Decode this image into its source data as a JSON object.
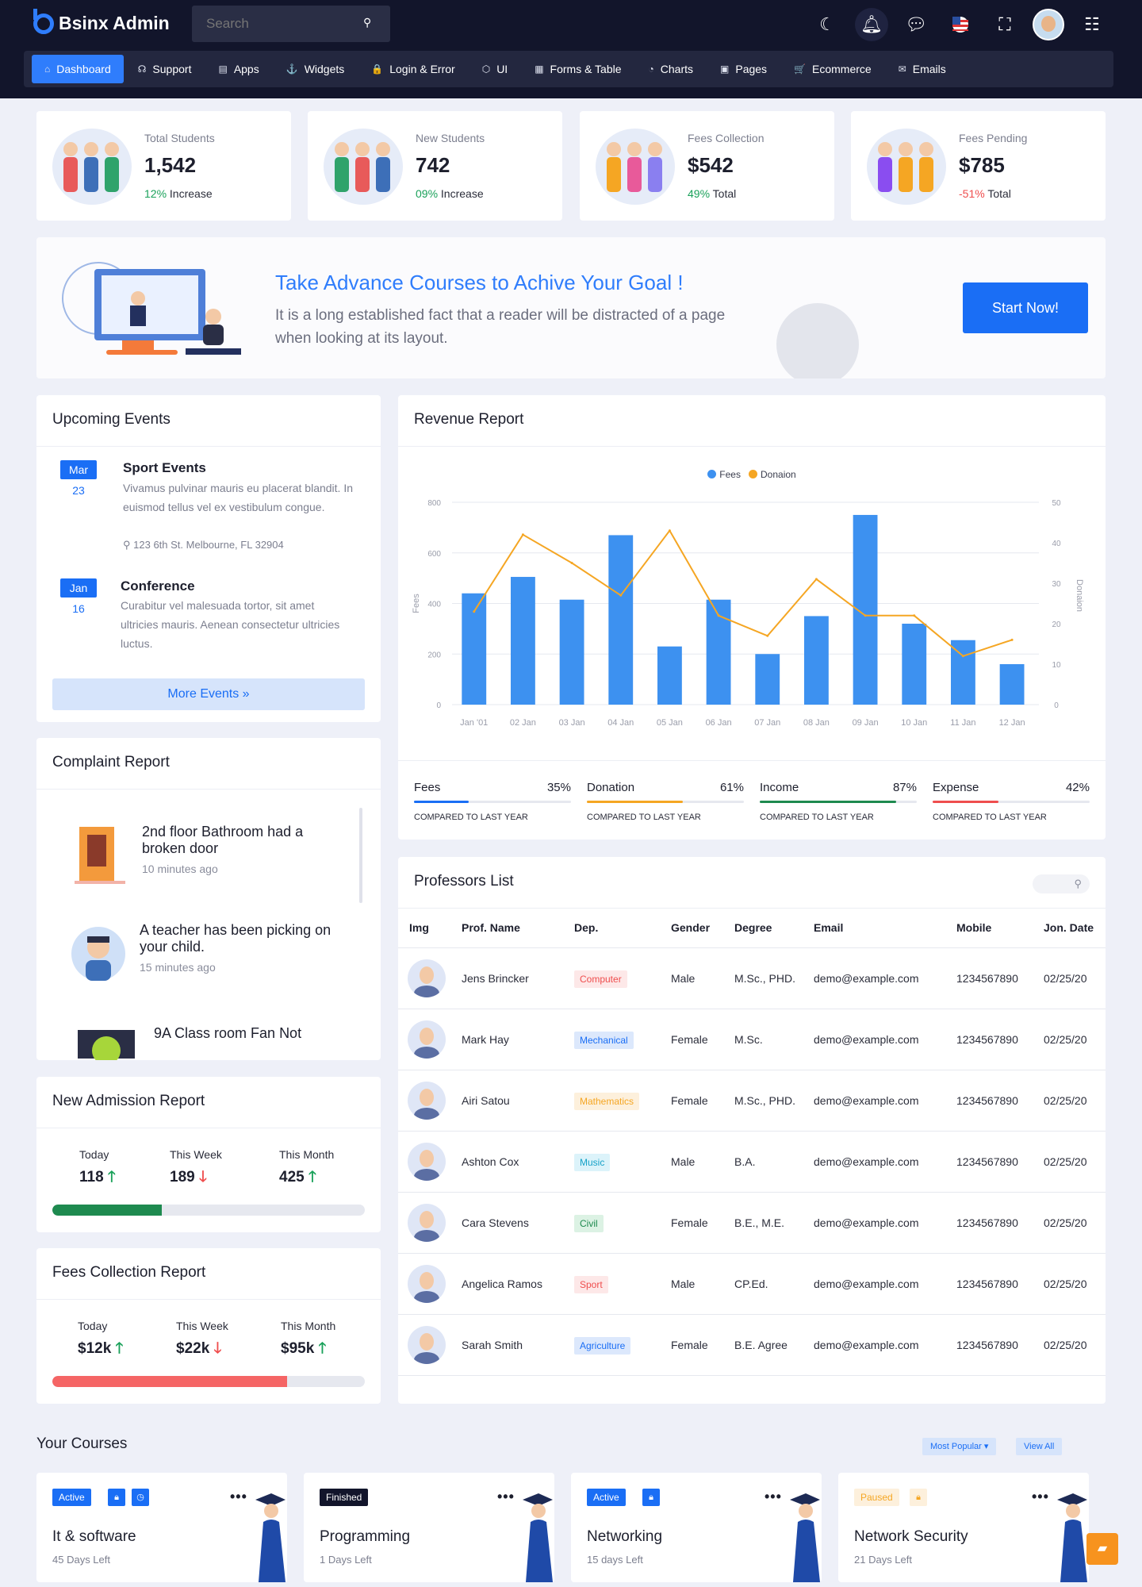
{
  "header": {
    "app_title": "Bsinx Admin",
    "search_placeholder": "Search",
    "icons": [
      "moon-icon",
      "bell-icon",
      "chat-icon",
      "flag-icon",
      "fullscreen-icon",
      "avatar",
      "settings-sliders-icon"
    ]
  },
  "nav": [
    {
      "label": "Dashboard",
      "icon": "home-icon",
      "glyph": "⌂",
      "active": true
    },
    {
      "label": "Support",
      "icon": "headset-icon",
      "glyph": "☊"
    },
    {
      "label": "Apps",
      "icon": "apps-icon",
      "glyph": "▤"
    },
    {
      "label": "Widgets",
      "icon": "anchor-icon",
      "glyph": "⚓"
    },
    {
      "label": "Login & Error",
      "icon": "lock-icon",
      "glyph": "🔒"
    },
    {
      "label": "UI",
      "icon": "box-icon",
      "glyph": "⬡"
    },
    {
      "label": "Forms & Table",
      "icon": "table-icon",
      "glyph": "▦"
    },
    {
      "label": "Charts",
      "icon": "pie-icon",
      "glyph": "◔"
    },
    {
      "label": "Pages",
      "icon": "page-icon",
      "glyph": "▣"
    },
    {
      "label": "Ecommerce",
      "icon": "cart-icon",
      "glyph": "🛒"
    },
    {
      "label": "Emails",
      "icon": "mail-icon",
      "glyph": "✉"
    }
  ],
  "stats": [
    {
      "label": "Total Students",
      "value": "1,542",
      "pct": "12%",
      "note": "Increase",
      "trend": "up"
    },
    {
      "label": "New Students",
      "value": "742",
      "pct": "09%",
      "note": "Increase",
      "trend": "up"
    },
    {
      "label": "Fees Collection",
      "value": "$542",
      "pct": "49%",
      "note": "Total",
      "trend": "up"
    },
    {
      "label": "Fees Pending",
      "value": "$785",
      "pct": "-51%",
      "note": "Total",
      "trend": "down"
    }
  ],
  "banner": {
    "title": "Take Advance Courses to Achive Your Goal !",
    "text": "It is a long established fact that a reader will be distracted of a page when looking at its layout.",
    "button": "Start Now!"
  },
  "events": {
    "title": "Upcoming Events",
    "items": [
      {
        "month": "Mar",
        "day": "23",
        "title": "Sport Events",
        "desc": "Vivamus pulvinar mauris eu placerat blandit. In euismod tellus vel ex vestibulum congue.",
        "address": "123 6th St. Melbourne, FL 32904"
      },
      {
        "month": "Jan",
        "day": "16",
        "title": "Conference",
        "desc": "Curabitur vel malesuada tortor, sit amet ultricies mauris. Aenean consectetur ultricies luctus."
      }
    ],
    "button": "More Events »"
  },
  "complaints": {
    "title": "Complaint Report",
    "items": [
      {
        "title": "2nd floor Bathroom had a broken door",
        "time": "10 minutes ago"
      },
      {
        "title": "A teacher has been picking on your child.",
        "time": "15 minutes ago"
      },
      {
        "title": "9A Class room Fan Not",
        "time": ""
      }
    ]
  },
  "admission": {
    "title": "New Admission Report",
    "cols": [
      {
        "label": "Today",
        "value": "118",
        "trend": "up"
      },
      {
        "label": "This Week",
        "value": "189",
        "trend": "down"
      },
      {
        "label": "This Month",
        "value": "425",
        "trend": "up"
      }
    ],
    "progress": 0.35,
    "color": "#1e8a4f"
  },
  "fees": {
    "title": "Fees Collection Report",
    "cols": [
      {
        "label": "Today",
        "value": "$12k",
        "trend": "up"
      },
      {
        "label": "This Week",
        "value": "$22k",
        "trend": "down"
      },
      {
        "label": "This Month",
        "value": "$95k",
        "trend": "up"
      }
    ],
    "progress": 0.75,
    "color": "#f56565"
  },
  "revenue": {
    "title": "Revenue Report",
    "kpis": [
      {
        "label": "Fees",
        "pct": "35%",
        "value": 0.35,
        "color": "#1a6ef5",
        "sub": "COMPARED TO LAST YEAR"
      },
      {
        "label": "Donation",
        "pct": "61%",
        "value": 0.61,
        "color": "#f5a623",
        "sub": "COMPARED TO LAST YEAR"
      },
      {
        "label": "Income",
        "pct": "87%",
        "value": 0.87,
        "color": "#1e8a4f",
        "sub": "COMPARED TO LAST YEAR"
      },
      {
        "label": "Expense",
        "pct": "42%",
        "value": 0.42,
        "color": "#ef4e4e",
        "sub": "COMPARED TO LAST YEAR"
      }
    ]
  },
  "chart_data": {
    "type": "bar",
    "categories": [
      "Jan '01",
      "02 Jan",
      "03 Jan",
      "04 Jan",
      "05 Jan",
      "06 Jan",
      "07 Jan",
      "08 Jan",
      "09 Jan",
      "10 Jan",
      "11 Jan",
      "12 Jan"
    ],
    "series": [
      {
        "name": "Fees",
        "type": "bar",
        "axis": "left",
        "color": "#3d91f0",
        "values": [
          440,
          505,
          415,
          670,
          230,
          415,
          200,
          350,
          750,
          320,
          255,
          160
        ]
      },
      {
        "name": "Donaion",
        "type": "line",
        "axis": "right",
        "color": "#f5a623",
        "values": [
          23,
          42,
          35,
          27,
          43,
          22,
          17,
          31,
          22,
          22,
          12,
          16
        ]
      }
    ],
    "ylabel": "Fees",
    "y2label": "Donaion",
    "ylim": [
      0,
      800
    ],
    "y2lim": [
      0,
      50
    ],
    "yticks": [
      "0",
      "200",
      "400",
      "600",
      "800"
    ],
    "y2ticks": [
      "0",
      "10",
      "20",
      "30",
      "40",
      "50"
    ],
    "legend": "top-center",
    "grid": true
  },
  "professors": {
    "title": "Professors List",
    "headers": [
      "Img",
      "Prof. Name",
      "Dep.",
      "Gender",
      "Degree",
      "Email",
      "Mobile",
      "Jon. Date"
    ],
    "rows": [
      {
        "name": "Jens Brincker",
        "dep": "Computer",
        "dep_color": "#ef4e4e",
        "dep_bg": "#fde8e8",
        "gender": "Male",
        "degree": "M.Sc., PHD.",
        "email": "demo@example.com",
        "mobile": "1234567890",
        "date": "02/25/20"
      },
      {
        "name": "Mark Hay",
        "dep": "Mechanical",
        "dep_color": "#1a6ef5",
        "dep_bg": "#dce8fc",
        "gender": "Female",
        "degree": "M.Sc.",
        "email": "demo@example.com",
        "mobile": "1234567890",
        "date": "02/25/20"
      },
      {
        "name": "Airi Satou",
        "dep": "Mathematics",
        "dep_color": "#f5a623",
        "dep_bg": "#fdf0dc",
        "gender": "Female",
        "degree": "M.Sc., PHD.",
        "email": "demo@example.com",
        "mobile": "1234567890",
        "date": "02/25/20"
      },
      {
        "name": "Ashton Cox",
        "dep": "Music",
        "dep_color": "#16a2c8",
        "dep_bg": "#dcf3fa",
        "gender": "Male",
        "degree": "B.A.",
        "email": "demo@example.com",
        "mobile": "1234567890",
        "date": "02/25/20"
      },
      {
        "name": "Cara Stevens",
        "dep": "Civil",
        "dep_color": "#1e8a4f",
        "dep_bg": "#dcf2e4",
        "gender": "Female",
        "degree": "B.E., M.E.",
        "email": "demo@example.com",
        "mobile": "1234567890",
        "date": "02/25/20"
      },
      {
        "name": "Angelica Ramos",
        "dep": "Sport",
        "dep_color": "#ef4e4e",
        "dep_bg": "#fde8e8",
        "gender": "Male",
        "degree": "CP.Ed.",
        "email": "demo@example.com",
        "mobile": "1234567890",
        "date": "02/25/20"
      },
      {
        "name": "Sarah Smith",
        "dep": "Agriculture",
        "dep_color": "#1a6ef5",
        "dep_bg": "#dce8fc",
        "gender": "Female",
        "degree": "B.E. Agree",
        "email": "demo@example.com",
        "mobile": "1234567890",
        "date": "02/25/20"
      }
    ]
  },
  "courses": {
    "title": "Your Courses",
    "filter": "Most Popular ▾",
    "view_all": "View All",
    "items": [
      {
        "status": "Active",
        "status_color": "#fff",
        "status_bg": "#1a6ef5",
        "icons": [
          "lock-icon",
          "clock-icon"
        ],
        "name": "It & software",
        "sub": "45 Days Left"
      },
      {
        "status": "Finished",
        "status_color": "#fff",
        "status_bg": "#12152b",
        "icons": [],
        "name": "Programming",
        "sub": "1 Days Left"
      },
      {
        "status": "Active",
        "status_color": "#fff",
        "status_bg": "#1a6ef5",
        "icons": [
          "lock-icon"
        ],
        "name": "Networking",
        "sub": "15 days Left"
      },
      {
        "status": "Paused",
        "status_color": "#f5a623",
        "status_bg": "#fdf0dc",
        "icons": [
          "lock-icon"
        ],
        "name": "Network Security",
        "sub": "21 Days Left"
      }
    ]
  }
}
